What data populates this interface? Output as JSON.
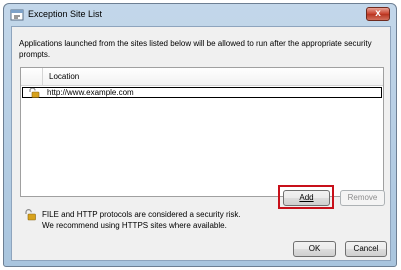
{
  "window": {
    "title": "Exception Site List",
    "close_label": "x"
  },
  "description": "Applications launched from the sites listed below will be allowed to run after the appropriate security prompts.",
  "table": {
    "column_header": "Location",
    "rows": [
      {
        "url": "http://www.example.com"
      }
    ]
  },
  "buttons": {
    "add_label": "Add",
    "remove_label": "Remove",
    "ok_label": "OK",
    "cancel_label": "Cancel"
  },
  "note": {
    "line1": "FILE and HTTP protocols are considered a security risk.",
    "line2": "We recommend using HTTPS sites where available."
  },
  "colors": {
    "highlight": "#c8101a",
    "close_button": "#c8402c"
  }
}
